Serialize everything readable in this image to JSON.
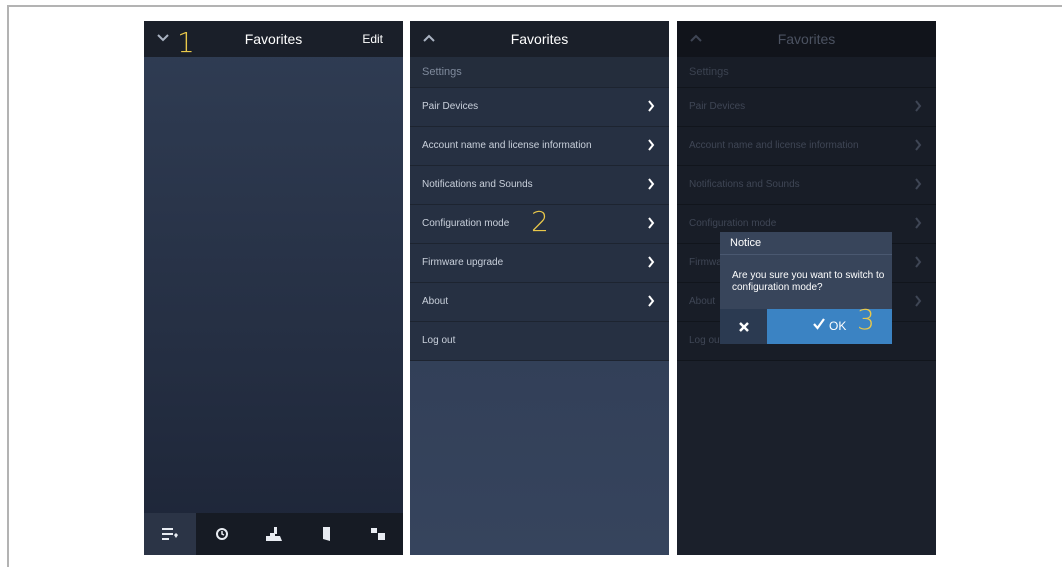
{
  "screen1": {
    "title": "Favorites",
    "edit_label": "Edit",
    "step_number": "1",
    "tabs": [
      {
        "icon": "favorites-list-icon",
        "active": true
      },
      {
        "icon": "clock-icon",
        "active": false
      },
      {
        "icon": "camera-icon",
        "active": false
      },
      {
        "icon": "door-icon",
        "active": false
      },
      {
        "icon": "devices-icon",
        "active": false
      }
    ]
  },
  "screen2": {
    "title": "Favorites",
    "section": "Settings",
    "step_number": "2",
    "items": [
      {
        "label": "Pair Devices",
        "has_arrow": true
      },
      {
        "label": "Account name and license information",
        "has_arrow": true
      },
      {
        "label": "Notifications and Sounds",
        "has_arrow": true
      },
      {
        "label": "Configuration mode",
        "has_arrow": true
      },
      {
        "label": "Firmware upgrade",
        "has_arrow": true
      },
      {
        "label": "About",
        "has_arrow": true
      },
      {
        "label": "Log out",
        "has_arrow": false
      }
    ]
  },
  "screen3": {
    "title": "Favorites",
    "section": "Settings",
    "step_number": "3",
    "items": [
      {
        "label": "Pair Devices",
        "has_arrow": true
      },
      {
        "label": "Account name and license information",
        "has_arrow": true
      },
      {
        "label": "Notifications and Sounds",
        "has_arrow": true
      },
      {
        "label": "Configuration mode",
        "has_arrow": true
      },
      {
        "label": "Firmware upgrade",
        "has_arrow": true
      },
      {
        "label": "About",
        "has_arrow": true
      },
      {
        "label": "Log out",
        "has_arrow": false
      }
    ],
    "dialog": {
      "title": "Notice",
      "message": "Are you sure you want to switch to configuration mode?",
      "ok_label": "OK",
      "cancel_icon": "close-icon",
      "ok_icon": "checkmark-icon"
    }
  },
  "colors": {
    "step_number": "#e9c84a",
    "header": "#1a1f29",
    "ok_button": "#3b83c3",
    "dialog": "#38455b"
  }
}
